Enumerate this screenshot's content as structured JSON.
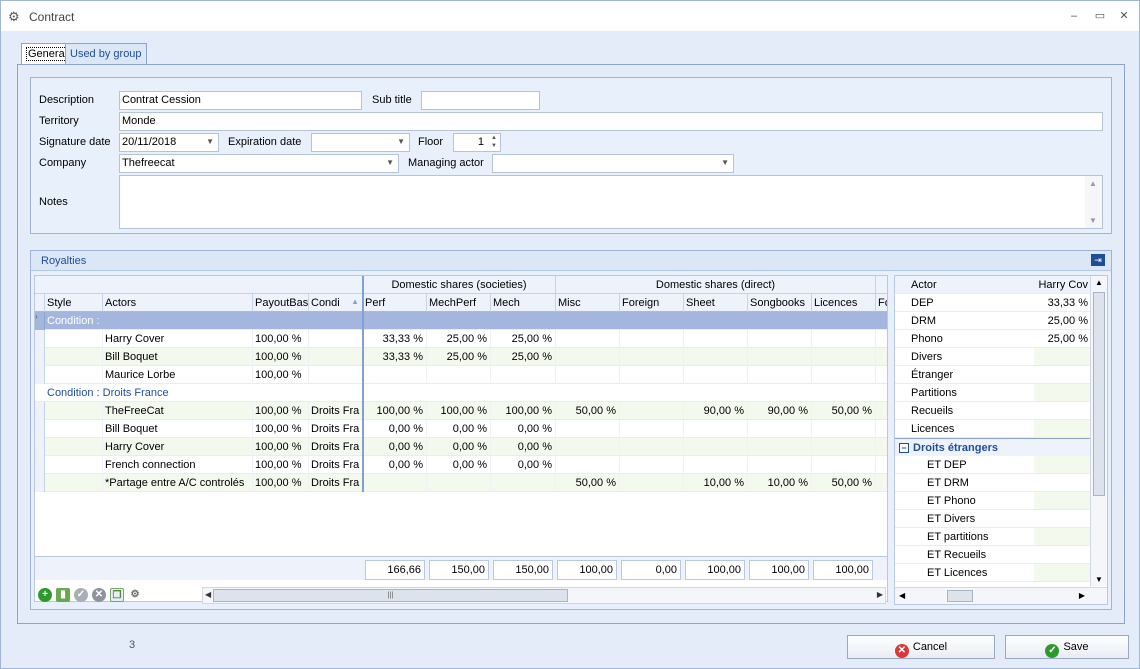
{
  "window": {
    "title": "Contract"
  },
  "tabs": [
    {
      "label": "General"
    },
    {
      "label": "Used by group"
    }
  ],
  "form": {
    "description_label": "Description",
    "description_value": "Contrat Cession",
    "subtitle_label": "Sub title",
    "subtitle_value": "",
    "territory_label": "Territory",
    "territory_value": "Monde",
    "signature_label": "Signature date",
    "signature_value": "20/11/2018",
    "expiration_label": "Expiration date",
    "expiration_value": "",
    "floor_label": "Floor",
    "floor_value": "1",
    "company_label": "Company",
    "company_value": "Thefreecat",
    "managing_label": "Managing actor",
    "managing_value": "",
    "notes_label": "Notes"
  },
  "royalties": {
    "title": "Royalties",
    "bands": {
      "societies": "Domestic shares (societies)",
      "direct": "Domestic shares (direct)"
    },
    "columns": [
      "Style",
      "Actors",
      "PayoutBase",
      "Condi",
      "Perf",
      "MechPerf",
      "Mech",
      "Misc",
      "Foreign",
      "Sheet",
      "Songbooks",
      "Licences",
      "Fo"
    ],
    "groups": [
      {
        "label": "Condition :",
        "rows": [
          {
            "actor": "Harry Cover",
            "payout": "100,00 %",
            "cond": "",
            "perf": "33,33 %",
            "mechperf": "25,00 %",
            "mech": "25,00 %",
            "misc": "",
            "foreign": "",
            "sheet": "",
            "songbooks": "",
            "licences": ""
          },
          {
            "actor": "Bill Boquet",
            "payout": "100,00 %",
            "cond": "",
            "perf": "33,33 %",
            "mechperf": "25,00 %",
            "mech": "25,00 %",
            "misc": "",
            "foreign": "",
            "sheet": "",
            "songbooks": "",
            "licences": ""
          },
          {
            "actor": "Maurice Lorbe",
            "payout": "100,00 %",
            "cond": "",
            "perf": "",
            "mechperf": "",
            "mech": "",
            "misc": "",
            "foreign": "",
            "sheet": "",
            "songbooks": "",
            "licences": ""
          }
        ]
      },
      {
        "label": "Condition : Droits France",
        "rows": [
          {
            "actor": "TheFreeCat",
            "payout": "100,00 %",
            "cond": "Droits Fra",
            "perf": "100,00 %",
            "mechperf": "100,00 %",
            "mech": "100,00 %",
            "misc": "50,00 %",
            "foreign": "",
            "sheet": "90,00 %",
            "songbooks": "90,00 %",
            "licences": "50,00 %"
          },
          {
            "actor": "Bill Boquet",
            "payout": "100,00 %",
            "cond": "Droits Fra",
            "perf": "0,00 %",
            "mechperf": "0,00 %",
            "mech": "0,00 %",
            "misc": "",
            "foreign": "",
            "sheet": "",
            "songbooks": "",
            "licences": ""
          },
          {
            "actor": "Harry Cover",
            "payout": "100,00 %",
            "cond": "Droits Fra",
            "perf": "0,00 %",
            "mechperf": "0,00 %",
            "mech": "0,00 %",
            "misc": "",
            "foreign": "",
            "sheet": "",
            "songbooks": "",
            "licences": ""
          },
          {
            "actor": "French connection",
            "payout": "100,00 %",
            "cond": "Droits Fra",
            "perf": "0,00 %",
            "mechperf": "0,00 %",
            "mech": "0,00 %",
            "misc": "",
            "foreign": "",
            "sheet": "",
            "songbooks": "",
            "licences": ""
          },
          {
            "actor": "*Partage entre A/C controlés",
            "payout": "100,00 %",
            "cond": "Droits Fra",
            "perf": "",
            "mechperf": "",
            "mech": "",
            "misc": "50,00 %",
            "foreign": "",
            "sheet": "10,00 %",
            "songbooks": "10,00 %",
            "licences": "50,00 %"
          }
        ]
      }
    ],
    "totals": [
      "166,66",
      "150,00",
      "150,00",
      "100,00",
      "0,00",
      "100,00",
      "100,00",
      "100,00"
    ]
  },
  "detail": {
    "header_key": "Actor",
    "header_value": "Harry Cov",
    "rows": [
      {
        "k": "DEP",
        "v": "33,33 %"
      },
      {
        "k": "DRM",
        "v": "25,00 %"
      },
      {
        "k": "Phono",
        "v": "25,00 %"
      },
      {
        "k": "Divers",
        "v": ""
      },
      {
        "k": "Étranger",
        "v": ""
      },
      {
        "k": "Partitions",
        "v": ""
      },
      {
        "k": "Recueils",
        "v": ""
      },
      {
        "k": "Licences",
        "v": ""
      }
    ],
    "category": "Droits étrangers",
    "subrows": [
      {
        "k": "ET DEP",
        "v": ""
      },
      {
        "k": "ET DRM",
        "v": ""
      },
      {
        "k": "ET Phono",
        "v": ""
      },
      {
        "k": "ET Divers",
        "v": ""
      },
      {
        "k": "ET partitions",
        "v": ""
      },
      {
        "k": "ET Recueils",
        "v": ""
      },
      {
        "k": "ET Licences",
        "v": ""
      }
    ]
  },
  "status": {
    "count": "3"
  },
  "buttons": {
    "cancel": "Cancel",
    "save": "Save"
  },
  "colors": {
    "accent": "#1f4e99",
    "selected_row": "#a5b6de",
    "add_green": "#2e9a2e",
    "cancel_red": "#d63a3a"
  }
}
